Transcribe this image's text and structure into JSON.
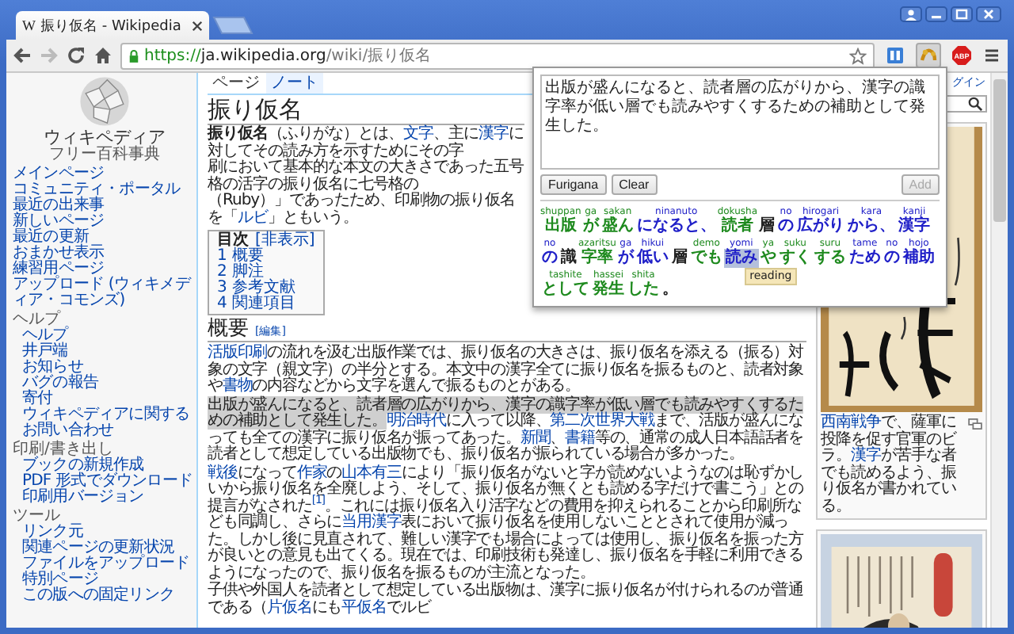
{
  "tab": {
    "favicon": "W",
    "title": "振り仮名 - Wikipedia"
  },
  "address": {
    "scheme": "https://",
    "host": "ja.wikipedia.org",
    "path": "/wiki/振り仮名"
  },
  "extensions": [
    {
      "kind": "book",
      "selected": false
    },
    {
      "kind": "furigana",
      "selected": true
    },
    {
      "kind": "adblock",
      "label": "ABP",
      "selected": false
    }
  ],
  "sidebar": {
    "title": "ウィキペディア",
    "subtitle": "フリー百科事典",
    "sections": [
      {
        "items": [
          "メインページ",
          "コミュニティ・ポータル",
          "最近の出来事",
          "新しいページ",
          "最近の更新",
          "おまかせ表示",
          "練習用ページ",
          "アップロード (ウィキメディア・コモンズ)"
        ]
      },
      {
        "heading": "ヘルプ",
        "items": [
          "ヘルプ",
          "井戸端",
          "お知らせ",
          "バグの報告",
          "寄付",
          "ウィキペディアに関するお問い合わせ"
        ]
      },
      {
        "heading": "印刷/書き出し",
        "items": [
          "ブックの新規作成",
          "PDF 形式でダウンロード",
          "印刷用バージョン"
        ]
      },
      {
        "heading": "ツール",
        "items": [
          "リンク元",
          "関連ページの更新状況",
          "ファイルをアップロード",
          "特別ページ",
          "この版への固定リンク"
        ]
      }
    ]
  },
  "page_tabs": [
    {
      "label": "ページ",
      "selected": true
    },
    {
      "label": "ノート",
      "selected": false
    }
  ],
  "login": "グイン",
  "article": {
    "title": "振り仮名",
    "intro_lines": [
      [
        {
          "kind": "bold",
          "text": "振り仮名"
        },
        {
          "kind": "text",
          "text": "（ふりがな）とは、"
        },
        {
          "kind": "link",
          "text": "文字"
        },
        {
          "kind": "text",
          "text": "、主に"
        },
        {
          "kind": "link",
          "text": "漢字"
        },
        {
          "kind": "text",
          "text": "に対してその読み方を示すためにその字"
        }
      ],
      [
        {
          "kind": "text",
          "text": "刷において基本的な本文の大きさであった五号格の活字の振り仮名に七号格の"
        }
      ],
      [
        {
          "kind": "text",
          "text": "（Ruby）」であったため、印刷物の振り仮名を「"
        },
        {
          "kind": "link",
          "text": "ルビ"
        },
        {
          "kind": "text",
          "text": "」ともいう。"
        }
      ]
    ],
    "toc": {
      "title": "目次",
      "toggle": "[非表示]",
      "items": [
        {
          "number": "1",
          "label": "概要"
        },
        {
          "number": "2",
          "label": "脚注"
        },
        {
          "number": "3",
          "label": "参考文献"
        },
        {
          "number": "4",
          "label": "関連項目"
        }
      ]
    },
    "section": {
      "title": "概要",
      "edit": "[編集]",
      "paragraphs": [
        [
          {
            "kind": "link",
            "text": "活版印刷"
          },
          {
            "kind": "text",
            "text": "の流れを汲む出版作業では、振り仮名の大きさは、振り仮名を添える（振る）対象の文字（親文字）の半分とする。本文中の漢字全てに振り仮名を振るものと、読者対象や"
          },
          {
            "kind": "link",
            "text": "書物"
          },
          {
            "kind": "text",
            "text": "の内容などから文字を選んで振るものとがある。"
          }
        ],
        [
          {
            "kind": "highlight",
            "text": "出版が盛んになると、読者層の広がりから、漢字の識字率が低い層でも読みやすくするための補助として発生した。"
          },
          {
            "kind": "link",
            "text": "明治時代"
          },
          {
            "kind": "text",
            "text": "に入って以降、"
          },
          {
            "kind": "link",
            "text": "第二次世界大戦"
          },
          {
            "kind": "text",
            "text": "まで、活版が盛んになっても全ての漢字に振り仮名が振ってあった。"
          },
          {
            "kind": "link",
            "text": "新聞"
          },
          {
            "kind": "text",
            "text": "、"
          },
          {
            "kind": "link",
            "text": "書籍"
          },
          {
            "kind": "text",
            "text": "等の、通常の成人日本語話者を読者として想定している出版物でも、振り仮名が振られている場合が多かった。"
          }
        ],
        [
          {
            "kind": "link",
            "text": "戦後"
          },
          {
            "kind": "text",
            "text": "になって"
          },
          {
            "kind": "link",
            "text": "作家"
          },
          {
            "kind": "text",
            "text": "の"
          },
          {
            "kind": "link",
            "text": "山本有三"
          },
          {
            "kind": "text",
            "text": "により「振り仮名がないと字が読めないようなのは恥ずかしいから振り仮名を全廃しよう、そして、振り仮名が無くとも読める字だけで書こう」との提言がなされた"
          },
          {
            "kind": "ref",
            "text": "[1]"
          },
          {
            "kind": "text",
            "text": "。これには振り仮名入り活字などの費用を抑えられることから印刷所なども同調し、さらに"
          },
          {
            "kind": "link",
            "text": "当用漢字"
          },
          {
            "kind": "text",
            "text": "表において振り仮名を使用しないこととされて使用が減った。しかし後に見直されて、難しい漢字でも場合によっては使用し、振り仮名を振った方が良いとの意見も出てくる。現在では、印刷技術も発達し、振り仮名を手軽に利用できるようになったので、振り仮名を振るものが主流となった。"
          }
        ],
        [
          {
            "kind": "text",
            "text": "子供や外国人を読者として想定している出版物は、漢字に振り仮名が付けられるのが普通である（"
          },
          {
            "kind": "link",
            "text": "片仮名"
          },
          {
            "kind": "text",
            "text": "にも"
          },
          {
            "kind": "link",
            "text": "平仮名"
          },
          {
            "kind": "text",
            "text": "でルビ"
          }
        ]
      ]
    }
  },
  "figures": [
    {
      "kind": "picture",
      "caption": [
        {
          "kind": "link",
          "text": "西南戦争"
        },
        {
          "kind": "text",
          "text": "で、薩軍に投降を促す官軍のビラ。"
        },
        {
          "kind": "link",
          "text": "漢字"
        },
        {
          "kind": "text",
          "text": "が苦手な者でも読めるよう、振り仮名が書かれている。"
        }
      ]
    },
    {
      "kind": "picture"
    }
  ],
  "furigana_popup": {
    "input": "出版が盛んになると、読者層の広がりから、漢字の識字率が低い層でも読みやすくするための補助として発生した。",
    "buttons": [
      {
        "label": "Furigana",
        "disabled": false
      },
      {
        "label": "Clear",
        "disabled": false
      },
      {
        "label": "Add",
        "disabled": true
      }
    ],
    "tokens": [
      {
        "base": "出版",
        "reading": "shuppan",
        "color": "#1e8a1e",
        "selected": false
      },
      {
        "base": "が",
        "reading": "ga",
        "color": "#1e8a1e",
        "selected": false
      },
      {
        "base": "盛ん",
        "reading": "sakan",
        "color": "#1e8a1e",
        "selected": false
      },
      {
        "base": "になると、",
        "reading": "ninanuto",
        "color": "#2020c8",
        "selected": false
      },
      {
        "base": "読者",
        "reading": "dokusha",
        "color": "#1e8a1e",
        "selected": false
      },
      {
        "base": "層",
        "color": "#222222",
        "selected": false
      },
      {
        "base": "の",
        "reading": "no",
        "color": "#2020c8",
        "selected": false
      },
      {
        "base": "広がり",
        "reading": "hirogari",
        "color": "#2020c8",
        "selected": false
      },
      {
        "base": "から、",
        "reading": "kara",
        "color": "#2020c8",
        "selected": false
      },
      {
        "base": "漢字",
        "reading": "kanji",
        "color": "#2020c8",
        "selected": false
      },
      {
        "base": "の",
        "reading": "no",
        "color": "#2020c8",
        "selected": false
      },
      {
        "base": "識",
        "color": "#222222",
        "selected": false
      },
      {
        "base": "字率",
        "reading": "azaritsu",
        "color": "#1e8a1e",
        "selected": false
      },
      {
        "base": "が",
        "reading": "ga",
        "color": "#2020c8",
        "selected": false
      },
      {
        "base": "低い",
        "reading": "hikui",
        "color": "#2020c8",
        "selected": false
      },
      {
        "base": "層",
        "color": "#222222",
        "selected": false
      },
      {
        "base": "でも",
        "reading": "demo",
        "color": "#1e8a1e",
        "selected": false
      },
      {
        "base": "読み",
        "reading": "yomi",
        "color": "#2020c8",
        "selected": true
      },
      {
        "base": "や",
        "reading": "ya",
        "color": "#1e8a1e",
        "selected": false
      },
      {
        "base": "すく",
        "reading": "suku",
        "color": "#1e8a1e",
        "selected": false
      },
      {
        "base": "する",
        "reading": "suru",
        "color": "#1e8a1e",
        "selected": false
      },
      {
        "base": "ため",
        "reading": "tame",
        "color": "#2020c8",
        "selected": false
      },
      {
        "base": "の",
        "reading": "no",
        "color": "#2020c8",
        "selected": false
      },
      {
        "base": "補助",
        "reading": "hojo",
        "color": "#2020c8",
        "selected": false
      },
      {
        "base": "として",
        "reading": "tashite",
        "color": "#1e8a1e",
        "selected": false
      },
      {
        "base": "発生",
        "reading": "hassei",
        "color": "#1e8a1e",
        "selected": false
      },
      {
        "base": "した",
        "reading": "shita",
        "color": "#1e8a1e",
        "selected": false
      },
      {
        "base": "。",
        "color": "#222222",
        "selected": false
      }
    ],
    "tooltip": "reading"
  }
}
